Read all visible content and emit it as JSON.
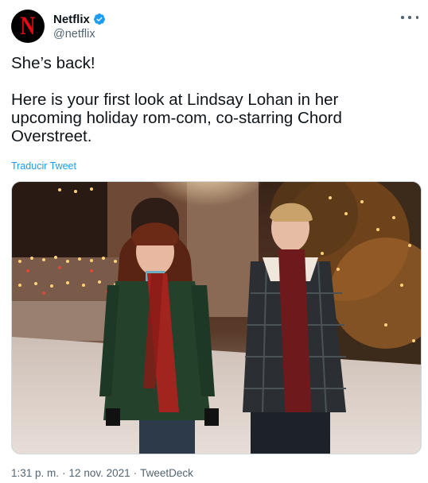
{
  "author": {
    "display_name": "Netflix",
    "handle": "@netflix",
    "avatar_letter": "N",
    "verified": true,
    "brand_color": "#e50914",
    "verified_color": "#1d9bf0"
  },
  "tweet": {
    "text": "She’s back!\n\nHere is your first look at Lindsay Lohan in her upcoming holiday rom-com, co-starring Chord Overstreet.",
    "translate_label": "Traducir Tweet"
  },
  "meta": {
    "time": "1:31 p. m.",
    "separator1": "·",
    "date": "12 nov. 2021",
    "separator2": "·",
    "source": "TweetDeck"
  },
  "icons": [
    "verified-badge-icon",
    "more-options-icon"
  ]
}
